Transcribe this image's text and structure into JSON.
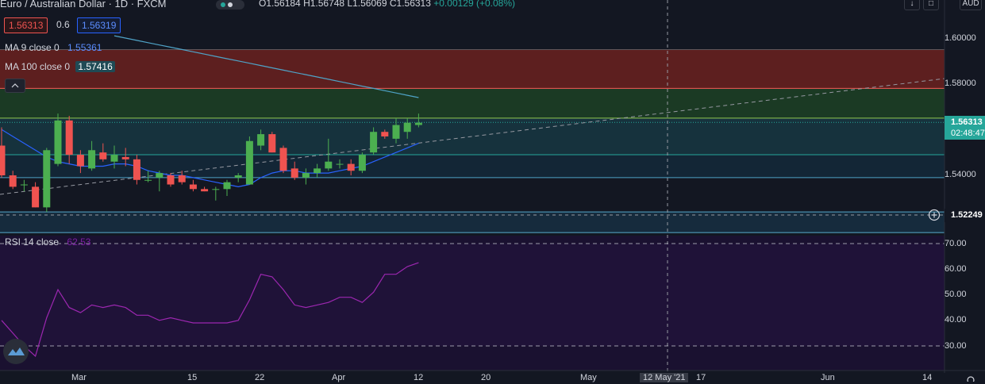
{
  "header": {
    "symbol": "Euro / Australian Dollar · 1D · FXCM",
    "open": "O1.56184",
    "high": "H1.56748",
    "low": "L1.56069",
    "close": "C1.56313",
    "change": "+0.00129 (+0.08%)"
  },
  "trade": {
    "sell_price": "1.56313",
    "spread": "0.6",
    "buy_price": "1.56319"
  },
  "indicators": {
    "ma9_label": "MA 9 close 0",
    "ma9_value": "1.55361",
    "ma100_label": "MA 100 close 0",
    "ma100_value": "1.57416",
    "rsi_label": "RSI 14 close",
    "rsi_value": "62.53"
  },
  "top_right": {
    "currency": "AUD"
  },
  "price_axis": {
    "ticks": [
      "1.60000",
      "1.58000",
      "1.54000"
    ],
    "current_price": "1.56313",
    "countdown": "02:48:47",
    "crosshair_price": "1.52249"
  },
  "rsi_axis": {
    "ticks": [
      "70.00",
      "60.00",
      "50.00",
      "40.00",
      "30.00"
    ]
  },
  "time_axis": {
    "labels": [
      "Mar",
      "15",
      "22",
      "Apr",
      "12",
      "20",
      "May",
      "12 May '21",
      "17",
      "Jun",
      "14"
    ]
  },
  "colors": {
    "up": "#4caf50",
    "down": "#ef5350",
    "ma9": "#2962ff",
    "ma100": "#4fa3c7",
    "rsi": "#9c27b0",
    "accent_green": "#26a69a"
  },
  "chart_data": [
    {
      "type": "candlestick",
      "title": "Euro / Australian Dollar · 1D · FXCM",
      "ylim": [
        1.515,
        1.605
      ],
      "candles": [
        {
          "o": 1.553,
          "h": 1.561,
          "l": 1.539,
          "c": 1.54
        },
        {
          "o": 1.54,
          "h": 1.542,
          "l": 1.534,
          "c": 1.535
        },
        {
          "o": 1.536,
          "h": 1.538,
          "l": 1.533,
          "c": 1.536
        },
        {
          "o": 1.535,
          "h": 1.537,
          "l": 1.526,
          "c": 1.526
        },
        {
          "o": 1.526,
          "h": 1.552,
          "l": 1.524,
          "c": 1.551
        },
        {
          "o": 1.545,
          "h": 1.567,
          "l": 1.544,
          "c": 1.564
        },
        {
          "o": 1.564,
          "h": 1.566,
          "l": 1.545,
          "c": 1.549
        },
        {
          "o": 1.549,
          "h": 1.551,
          "l": 1.541,
          "c": 1.544
        },
        {
          "o": 1.543,
          "h": 1.555,
          "l": 1.542,
          "c": 1.551
        },
        {
          "o": 1.55,
          "h": 1.554,
          "l": 1.546,
          "c": 1.547
        },
        {
          "o": 1.546,
          "h": 1.553,
          "l": 1.543,
          "c": 1.549
        },
        {
          "o": 1.548,
          "h": 1.552,
          "l": 1.544,
          "c": 1.547
        },
        {
          "o": 1.547,
          "h": 1.549,
          "l": 1.536,
          "c": 1.538
        },
        {
          "o": 1.538,
          "h": 1.542,
          "l": 1.537,
          "c": 1.538
        },
        {
          "o": 1.539,
          "h": 1.542,
          "l": 1.533,
          "c": 1.541
        },
        {
          "o": 1.54,
          "h": 1.541,
          "l": 1.535,
          "c": 1.536
        },
        {
          "o": 1.54,
          "h": 1.542,
          "l": 1.536,
          "c": 1.537
        },
        {
          "o": 1.536,
          "h": 1.538,
          "l": 1.533,
          "c": 1.534
        },
        {
          "o": 1.534,
          "h": 1.535,
          "l": 1.533,
          "c": 1.533
        },
        {
          "o": 1.534,
          "h": 1.535,
          "l": 1.529,
          "c": 1.534
        },
        {
          "o": 1.534,
          "h": 1.538,
          "l": 1.531,
          "c": 1.537
        },
        {
          "o": 1.539,
          "h": 1.541,
          "l": 1.537,
          "c": 1.54
        },
        {
          "o": 1.536,
          "h": 1.557,
          "l": 1.536,
          "c": 1.555
        },
        {
          "o": 1.553,
          "h": 1.56,
          "l": 1.551,
          "c": 1.558
        },
        {
          "o": 1.558,
          "h": 1.559,
          "l": 1.55,
          "c": 1.55
        },
        {
          "o": 1.552,
          "h": 1.553,
          "l": 1.541,
          "c": 1.542
        },
        {
          "o": 1.543,
          "h": 1.546,
          "l": 1.538,
          "c": 1.539
        },
        {
          "o": 1.539,
          "h": 1.543,
          "l": 1.536,
          "c": 1.541
        },
        {
          "o": 1.541,
          "h": 1.545,
          "l": 1.539,
          "c": 1.543
        },
        {
          "o": 1.543,
          "h": 1.556,
          "l": 1.542,
          "c": 1.546
        },
        {
          "o": 1.545,
          "h": 1.547,
          "l": 1.543,
          "c": 1.545
        },
        {
          "o": 1.545,
          "h": 1.547,
          "l": 1.54,
          "c": 1.542
        },
        {
          "o": 1.542,
          "h": 1.55,
          "l": 1.541,
          "c": 1.549
        },
        {
          "o": 1.55,
          "h": 1.561,
          "l": 1.549,
          "c": 1.559
        },
        {
          "o": 1.559,
          "h": 1.56,
          "l": 1.556,
          "c": 1.557
        },
        {
          "o": 1.556,
          "h": 1.565,
          "l": 1.554,
          "c": 1.562
        },
        {
          "o": 1.559,
          "h": 1.565,
          "l": 1.556,
          "c": 1.563
        },
        {
          "o": 1.562,
          "h": 1.567,
          "l": 1.561,
          "c": 1.563
        }
      ],
      "ma9": [
        1.56,
        1.557,
        1.554,
        1.551,
        1.548,
        1.546,
        1.545,
        1.544,
        1.544,
        1.544,
        1.545,
        1.545,
        1.544,
        1.542,
        1.541,
        1.54,
        1.54,
        1.539,
        1.538,
        1.537,
        1.536,
        1.535,
        1.536,
        1.539,
        1.541,
        1.542,
        1.542,
        1.541,
        1.541,
        1.541,
        1.542,
        1.543,
        1.544,
        1.546,
        1.548,
        1.55,
        1.552,
        1.554
      ],
      "ma100": [
        1.601,
        1.6,
        1.599,
        1.598,
        1.597,
        1.596,
        1.595,
        1.594,
        1.593,
        1.592,
        1.591,
        1.59,
        1.589,
        1.588,
        1.587,
        1.586,
        1.585,
        1.584,
        1.583,
        1.582,
        1.581,
        1.58,
        1.579,
        1.578,
        1.577,
        1.576,
        1.575,
        1.574
      ],
      "zones": [
        {
          "from": 1.578,
          "to": 1.595,
          "color": "#5d1f1f"
        },
        {
          "from": 1.565,
          "to": 1.578,
          "color": "#1b3a24"
        },
        {
          "from": 1.549,
          "to": 1.565,
          "color": "#16323d"
        },
        {
          "from": 1.539,
          "to": 1.549,
          "color": "#132636"
        },
        {
          "from": 1.515,
          "to": 1.524,
          "color": "#162b3d"
        }
      ]
    },
    {
      "type": "line",
      "title": "RSI 14 close",
      "ylim": [
        25,
        75
      ],
      "levels": [
        70,
        30
      ],
      "values": [
        40,
        35,
        30,
        26,
        41,
        52,
        45,
        43,
        46,
        45,
        46,
        45,
        42,
        42,
        40,
        41,
        40,
        39,
        39,
        39,
        39,
        40,
        48,
        58,
        57,
        52,
        46,
        45,
        46,
        47,
        49,
        49,
        47,
        51,
        58,
        58,
        61,
        62.53
      ]
    }
  ]
}
